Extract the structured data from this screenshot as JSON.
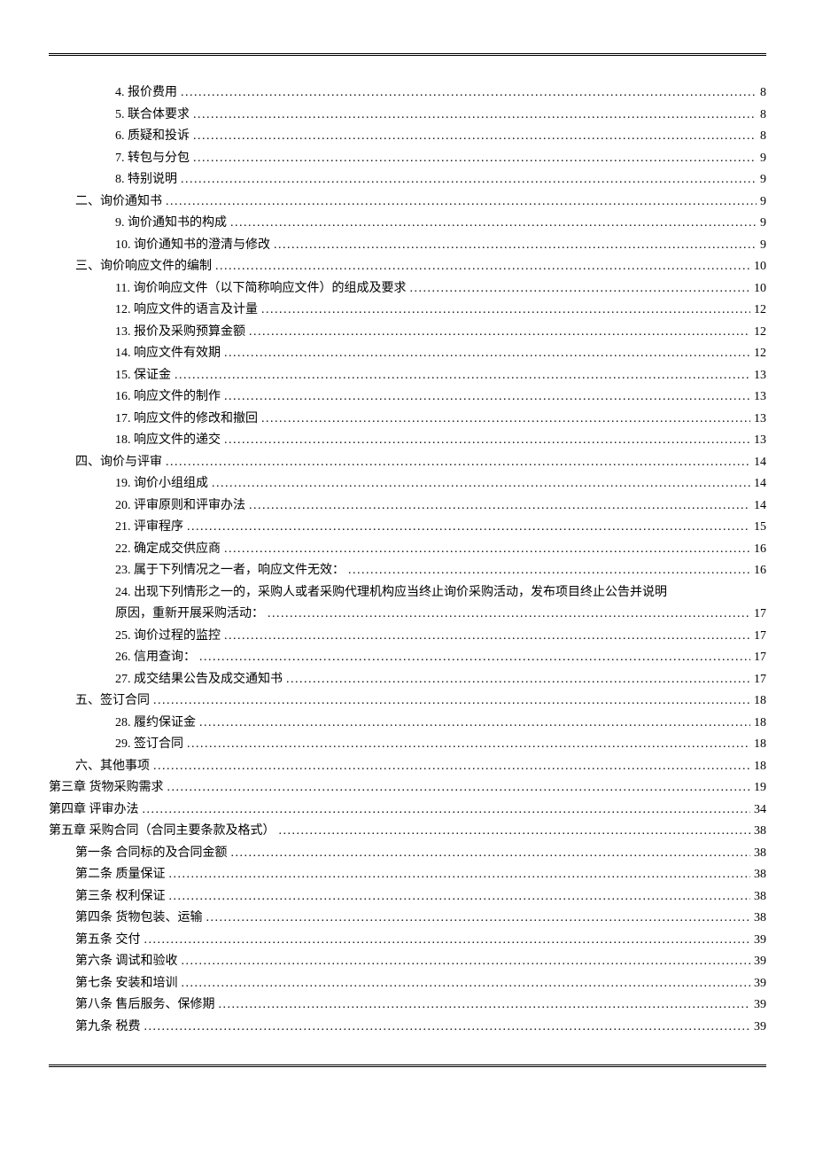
{
  "toc": [
    {
      "indent": "indent-3",
      "label": "4.  报价费用",
      "page": "8"
    },
    {
      "indent": "indent-3",
      "label": "5.  联合体要求",
      "page": "8"
    },
    {
      "indent": "indent-3",
      "label": "6.  质疑和投诉",
      "page": "8"
    },
    {
      "indent": "indent-3",
      "label": "7.  转包与分包",
      "page": "9"
    },
    {
      "indent": "indent-3",
      "label": "8.  特别说明",
      "page": "9"
    },
    {
      "indent": "indent-1",
      "label": "二、询价通知书",
      "page": "9"
    },
    {
      "indent": "indent-3",
      "label": "9.  询价通知书的构成",
      "page": "9"
    },
    {
      "indent": "indent-3",
      "label": "10.  询价通知书的澄清与修改",
      "page": "9"
    },
    {
      "indent": "indent-1",
      "label": "三、询价响应文件的编制",
      "page": "10"
    },
    {
      "indent": "indent-3",
      "label": "11. 询价响应文件（以下简称响应文件）的组成及要求",
      "page": "10"
    },
    {
      "indent": "indent-3",
      "label": "12.  响应文件的语言及计量",
      "page": "12"
    },
    {
      "indent": "indent-3",
      "label": "13.  报价及采购预算金额",
      "page": "12"
    },
    {
      "indent": "indent-3",
      "label": "14.  响应文件有效期",
      "page": "12"
    },
    {
      "indent": "indent-3",
      "label": "15.  保证金",
      "page": "13"
    },
    {
      "indent": "indent-3",
      "label": "16.  响应文件的制作",
      "page": "13"
    },
    {
      "indent": "indent-3",
      "label": "17.  响应文件的修改和撤回",
      "page": "13"
    },
    {
      "indent": "indent-3",
      "label": "18.  响应文件的递交",
      "page": "13"
    },
    {
      "indent": "indent-1",
      "label": "四、询价与评审",
      "page": "14"
    },
    {
      "indent": "indent-3",
      "label": "19.  询价小组组成",
      "page": "14"
    },
    {
      "indent": "indent-3",
      "label": "20.  评审原则和评审办法",
      "page": "14"
    },
    {
      "indent": "indent-3",
      "label": "21.  评审程序",
      "page": "15"
    },
    {
      "indent": "indent-3",
      "label": "22.  确定成交供应商",
      "page": "16"
    },
    {
      "indent": "indent-3",
      "label": "23.  属于下列情况之一者，响应文件无效：",
      "page": "16"
    },
    {
      "indent": "indent-3",
      "label": "24.  出现下列情形之一的，采购人或者采购代理机构应当终止询价采购活动，发布项目终止公告并说明原因，重新开展采购活动：",
      "page": "17",
      "multiline": true
    },
    {
      "indent": "indent-3",
      "label": "25.  询价过程的监控",
      "page": "17"
    },
    {
      "indent": "indent-3",
      "label": "26.  信用查询：",
      "page": "17"
    },
    {
      "indent": "indent-3",
      "label": "27.  成交结果公告及成交通知书",
      "page": "17"
    },
    {
      "indent": "indent-1",
      "label": "五、签订合同",
      "page": "18"
    },
    {
      "indent": "indent-3",
      "label": "28.  履约保证金",
      "page": "18"
    },
    {
      "indent": "indent-3",
      "label": "29.  签订合同",
      "page": "18"
    },
    {
      "indent": "indent-1",
      "label": "六、其他事项",
      "page": "18"
    },
    {
      "indent": "indent-0",
      "label": "第三章  货物采购需求",
      "page": "19"
    },
    {
      "indent": "indent-0",
      "label": "第四章  评审办法",
      "page": "34"
    },
    {
      "indent": "indent-0",
      "label": "第五章  采购合同（合同主要条款及格式）",
      "page": "38"
    },
    {
      "indent": "indent-chapter5",
      "label": "第一条   合同标的及合同金额",
      "page": "38"
    },
    {
      "indent": "indent-chapter5",
      "label": "第二条   质量保证",
      "page": "38"
    },
    {
      "indent": "indent-chapter5",
      "label": "第三条   权利保证",
      "page": "38"
    },
    {
      "indent": "indent-chapter5",
      "label": "第四条   货物包装、运输",
      "page": "38"
    },
    {
      "indent": "indent-chapter5",
      "label": "第五条   交付",
      "page": "39"
    },
    {
      "indent": "indent-chapter5",
      "label": "第六条   调试和验收",
      "page": "39"
    },
    {
      "indent": "indent-chapter5",
      "label": "第七条   安装和培训",
      "page": "39"
    },
    {
      "indent": "indent-chapter5",
      "label": "第八条   售后服务、保修期",
      "page": "39"
    },
    {
      "indent": "indent-chapter5",
      "label": "第九条   税费",
      "page": "39"
    }
  ]
}
